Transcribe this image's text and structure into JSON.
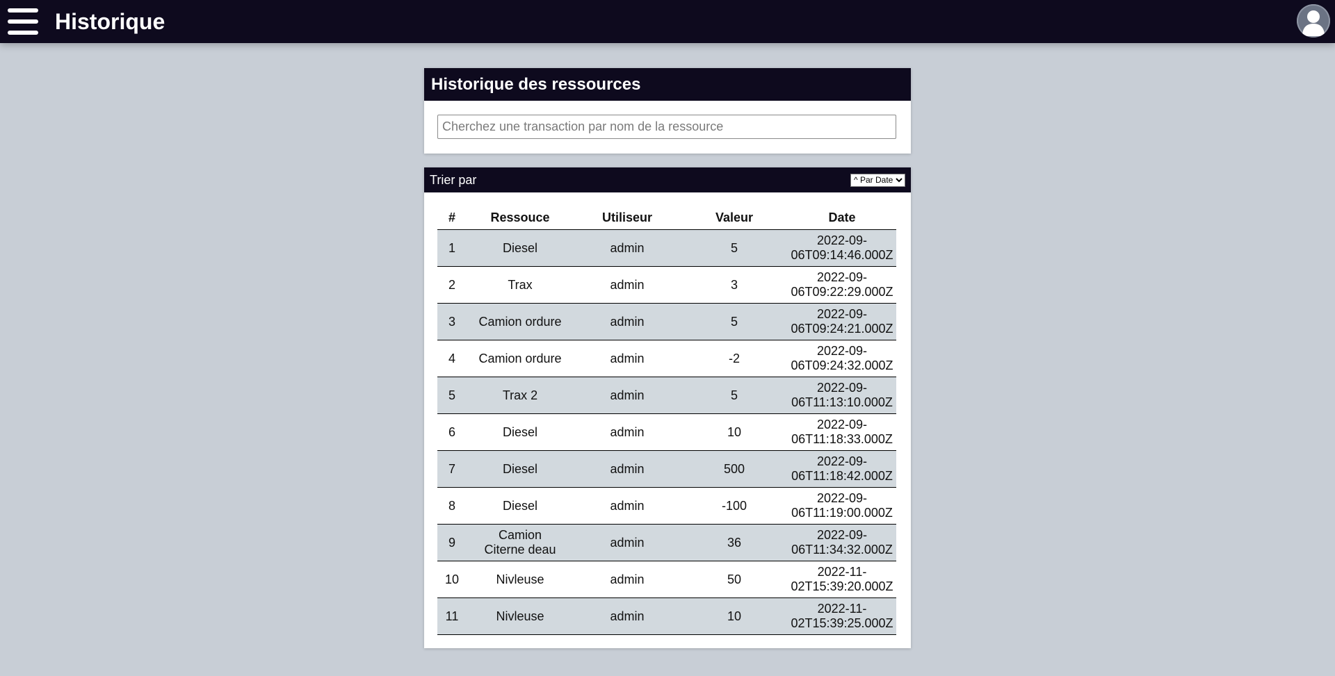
{
  "topbar": {
    "title": "Historique",
    "menu_icon": "hamburger-menu-icon",
    "avatar_icon": "user-avatar-icon"
  },
  "search_panel": {
    "title": "Historique des ressources",
    "placeholder": "Cherchez une transaction par nom de la ressource",
    "value": ""
  },
  "sort": {
    "label": "Trier par",
    "selected": "^ Par Date"
  },
  "table": {
    "headers": [
      "#",
      "Ressouce",
      "Utiliseur",
      "Valeur",
      "Date"
    ],
    "rows": [
      {
        "num": "1",
        "resource": "Diesel",
        "user": "admin",
        "value": "5",
        "date_a": "2022-09-",
        "date_b": "06T09:14:46.000Z"
      },
      {
        "num": "2",
        "resource": "Trax",
        "user": "admin",
        "value": "3",
        "date_a": "2022-09-",
        "date_b": "06T09:22:29.000Z"
      },
      {
        "num": "3",
        "resource": "Camion ordure",
        "user": "admin",
        "value": "5",
        "date_a": "2022-09-",
        "date_b": "06T09:24:21.000Z"
      },
      {
        "num": "4",
        "resource": "Camion ordure",
        "user": "admin",
        "value": "-2",
        "date_a": "2022-09-",
        "date_b": "06T09:24:32.000Z"
      },
      {
        "num": "5",
        "resource": "Trax 2",
        "user": "admin",
        "value": "5",
        "date_a": "2022-09-",
        "date_b": "06T11:13:10.000Z"
      },
      {
        "num": "6",
        "resource": "Diesel",
        "user": "admin",
        "value": "10",
        "date_a": "2022-09-",
        "date_b": "06T11:18:33.000Z"
      },
      {
        "num": "7",
        "resource": "Diesel",
        "user": "admin",
        "value": "500",
        "date_a": "2022-09-",
        "date_b": "06T11:18:42.000Z"
      },
      {
        "num": "8",
        "resource": "Diesel",
        "user": "admin",
        "value": "-100",
        "date_a": "2022-09-",
        "date_b": "06T11:19:00.000Z"
      },
      {
        "num": "9",
        "resource": "Camion Citerne deau",
        "user": "admin",
        "value": "36",
        "date_a": "2022-09-",
        "date_b": "06T11:34:32.000Z"
      },
      {
        "num": "10",
        "resource": "Nivleuse",
        "user": "admin",
        "value": "50",
        "date_a": "2022-11-",
        "date_b": "02T15:39:20.000Z"
      },
      {
        "num": "11",
        "resource": "Nivleuse",
        "user": "admin",
        "value": "10",
        "date_a": "2022-11-",
        "date_b": "02T15:39:25.000Z"
      }
    ]
  },
  "colors": {
    "header_bg": "#0e0a1e",
    "page_bg": "#c8ced6",
    "row_stripe": "#d2d9de"
  }
}
